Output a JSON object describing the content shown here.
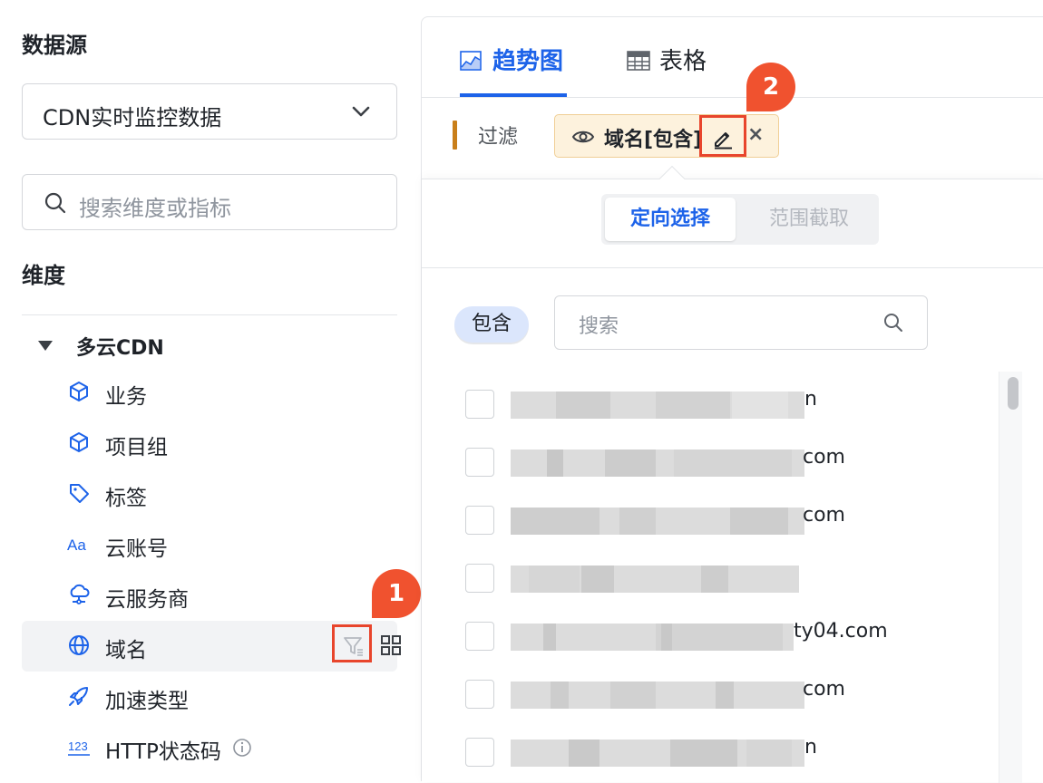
{
  "left": {
    "datasource_title": "数据源",
    "datasource_value": "CDN实时监控数据",
    "search_placeholder": "搜索维度或指标",
    "dimension_title": "维度",
    "group_label": "多云CDN",
    "items": [
      {
        "label": "业务",
        "icon": "cube-icon"
      },
      {
        "label": "项目组",
        "icon": "cube-icon"
      },
      {
        "label": "标签",
        "icon": "tag-icon"
      },
      {
        "label": "云账号",
        "icon": "font-aa-icon"
      },
      {
        "label": "云服务商",
        "icon": "cloud-network-icon"
      },
      {
        "label": "域名",
        "icon": "globe-icon"
      },
      {
        "label": "加速类型",
        "icon": "rocket-icon"
      },
      {
        "label": "HTTP状态码",
        "icon": "number-123-icon"
      }
    ]
  },
  "annotations": {
    "badge1": "1",
    "badge2": "2"
  },
  "right": {
    "tabs": [
      {
        "label": "趋势图",
        "icon": "area-chart-icon"
      },
      {
        "label": "表格",
        "icon": "table-icon"
      }
    ],
    "filter_label": "过滤",
    "filter_chip_text": "域名[包含]",
    "chip_close": "×",
    "segment_on": "定向选择",
    "segment_off": "范围截取",
    "mode_pill": "包含",
    "search_placeholder": "搜索",
    "options": [
      {
        "suffix": "n"
      },
      {
        "suffix": "com"
      },
      {
        "suffix": "com"
      },
      {
        "suffix": ""
      },
      {
        "suffix": "ty04.com"
      },
      {
        "suffix": "com"
      },
      {
        "suffix": "n"
      }
    ]
  },
  "colors": {
    "accent": "#1d63e9",
    "annotation": "#f0522f",
    "chip_bg": "#fdf2dd"
  }
}
